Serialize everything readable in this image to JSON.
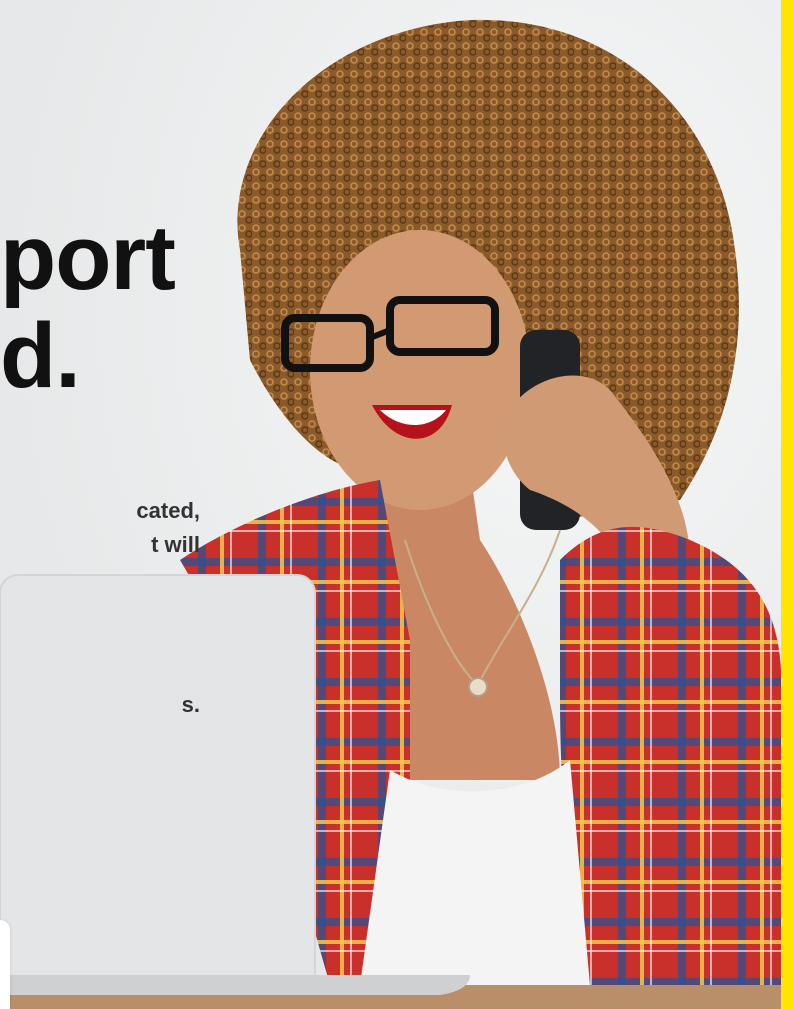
{
  "hero": {
    "headline_line1": "port",
    "headline_line2": "d.",
    "body_line1": "cated,",
    "body_line2": "t will",
    "body_line3": "s."
  },
  "image": {
    "description_icon": "woman-on-phone-with-laptop-photo"
  },
  "colors": {
    "accent": "#ffe500",
    "background": "#f1f2f2",
    "headline": "#111111",
    "body": "#333333"
  }
}
